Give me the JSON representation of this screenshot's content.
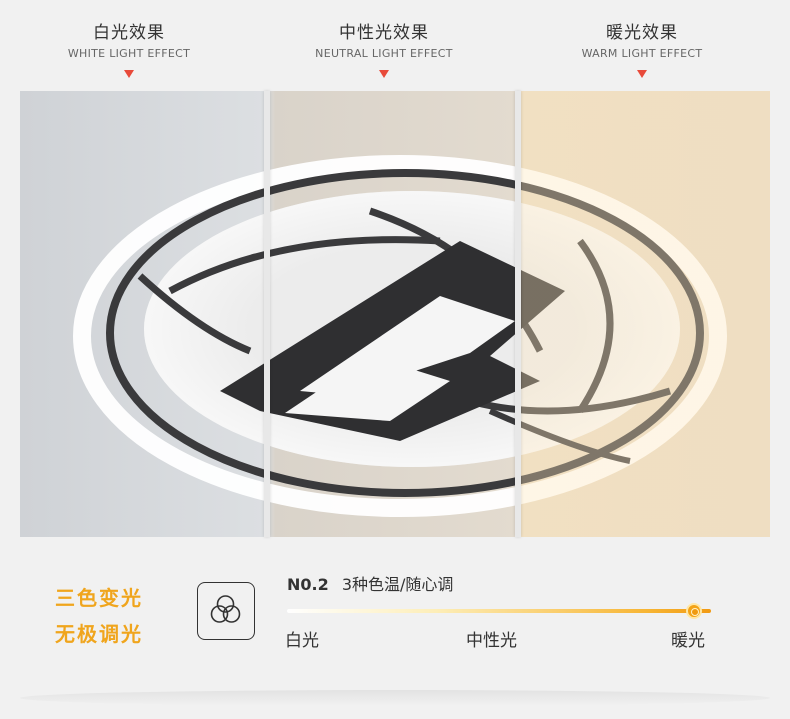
{
  "headers": [
    {
      "cn": "白光效果",
      "en": "WHITE LIGHT EFFECT"
    },
    {
      "cn": "中性光效果",
      "en": "NEUTRAL LIGHT EFFECT"
    },
    {
      "cn": "暖光效果",
      "en": "WARM LIGHT EFFECT"
    }
  ],
  "features": {
    "line1": "三色变光",
    "line2": "无极调光"
  },
  "spec": {
    "number": "N0.2",
    "text": "3种色温/随心调"
  },
  "slider": {
    "value": 0.96,
    "labels": [
      "白光",
      "中性光",
      "暖光"
    ]
  },
  "colors": {
    "accent": "#f0a51d",
    "marker": "#e84a3a",
    "white_tint": "#dfe1e3",
    "neutral_tint": "#e7dfd4",
    "warm_tint": "#f0e3cc"
  },
  "icons": {
    "color_temp": "three-circles-icon"
  }
}
